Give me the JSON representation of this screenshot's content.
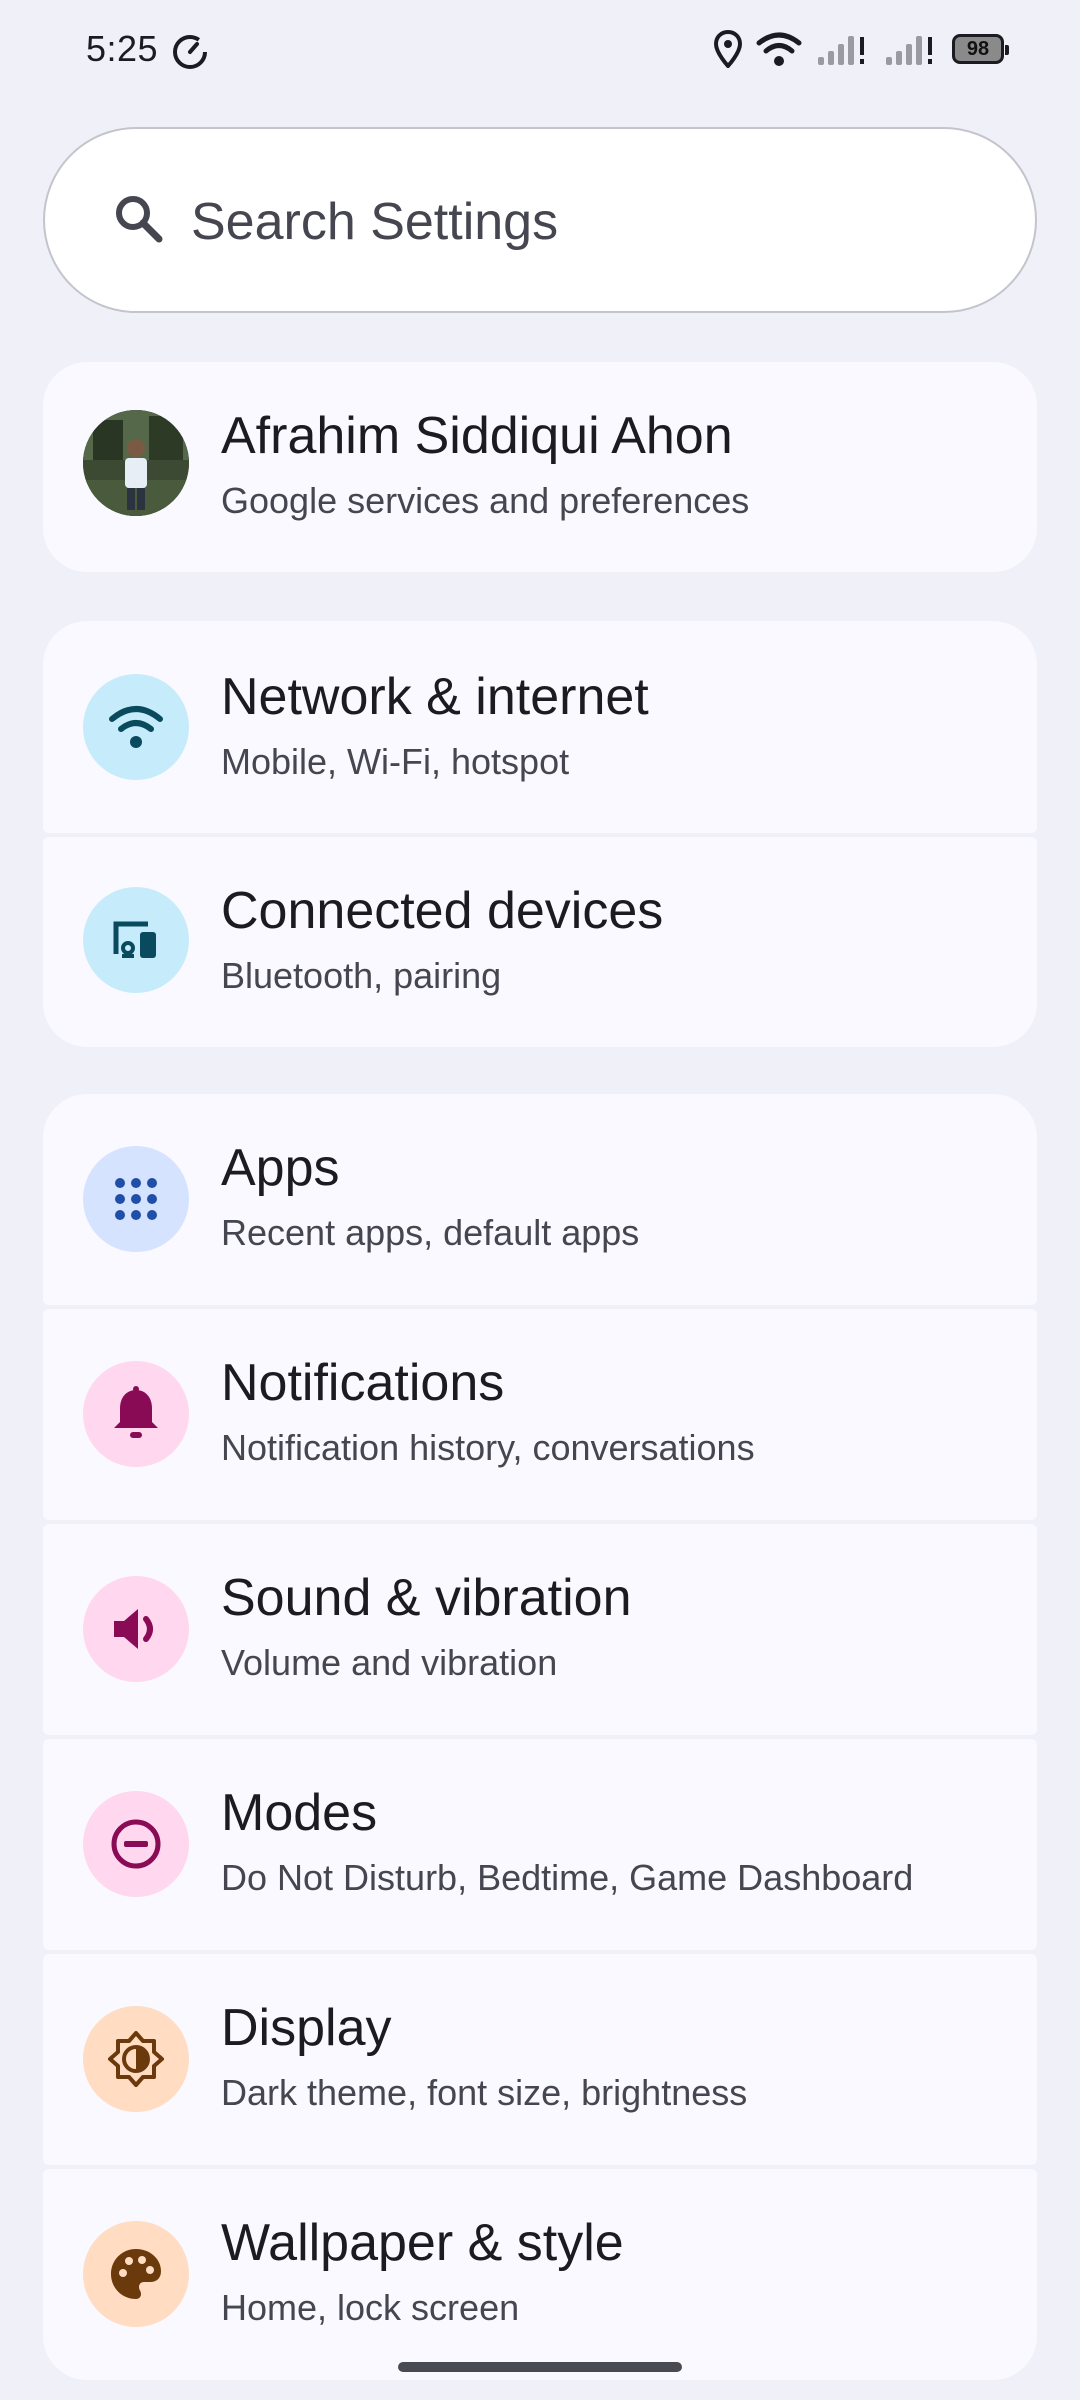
{
  "status": {
    "time": "5:25",
    "battery": "98"
  },
  "search": {
    "placeholder": "Search Settings"
  },
  "account": {
    "name": "Afrahim Siddiqui Ahon",
    "subtitle": "Google services and preferences"
  },
  "items": [
    {
      "title": "Network & internet",
      "subtitle": "Mobile, Wi-Fi, hotspot",
      "icon": "wifi-icon",
      "icon_bg": "#c6ecfb",
      "icon_color": "#0a4a5e"
    },
    {
      "title": "Connected devices",
      "subtitle": "Bluetooth, pairing",
      "icon": "devices-icon",
      "icon_bg": "#c6ecfb",
      "icon_color": "#0a4a5e"
    },
    {
      "title": "Apps",
      "subtitle": "Recent apps, default apps",
      "icon": "apps-grid-icon",
      "icon_bg": "#d6e3ff",
      "icon_color": "#1f4fa8"
    },
    {
      "title": "Notifications",
      "subtitle": "Notification history, conversations",
      "icon": "bell-icon",
      "icon_bg": "#ffd7ee",
      "icon_color": "#8a0b55"
    },
    {
      "title": "Sound & vibration",
      "subtitle": "Volume and vibration",
      "icon": "speaker-icon",
      "icon_bg": "#ffd7ee",
      "icon_color": "#8a0b55"
    },
    {
      "title": "Modes",
      "subtitle": "Do Not Disturb, Bedtime, Game Dashboard",
      "icon": "do-not-disturb-icon",
      "icon_bg": "#ffd7ee",
      "icon_color": "#8a0b55"
    },
    {
      "title": "Display",
      "subtitle": "Dark theme, font size, brightness",
      "icon": "brightness-icon",
      "icon_bg": "#ffdcc2",
      "icon_color": "#6b3a0c"
    },
    {
      "title": "Wallpaper & style",
      "subtitle": "Home, lock screen",
      "icon": "palette-icon",
      "icon_bg": "#ffdcc2",
      "icon_color": "#6b3a0c"
    }
  ]
}
